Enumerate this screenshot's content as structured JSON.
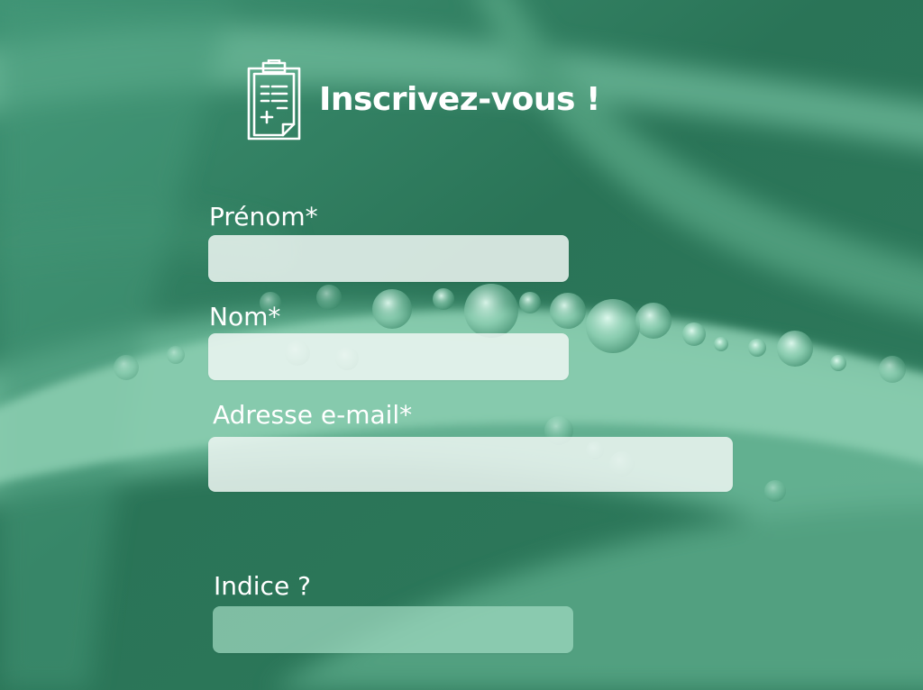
{
  "page": {
    "title": "Inscrivez-vous !",
    "header_icon": "clipboard-form-icon"
  },
  "form": {
    "first_name": {
      "label": "Prénom*",
      "value": "",
      "placeholder": ""
    },
    "last_name": {
      "label": "Nom*",
      "value": "",
      "placeholder": ""
    },
    "email": {
      "label": "Adresse e-mail*",
      "value": "",
      "placeholder": ""
    },
    "hint": {
      "label": "Indice ?",
      "value": "",
      "placeholder": ""
    }
  },
  "colors": {
    "background": "#2f7d5e",
    "background_light": "#8fd0b4",
    "text": "#ffffff",
    "input_fill": "#eef6f2",
    "hint_fill": "#a0dac0"
  }
}
